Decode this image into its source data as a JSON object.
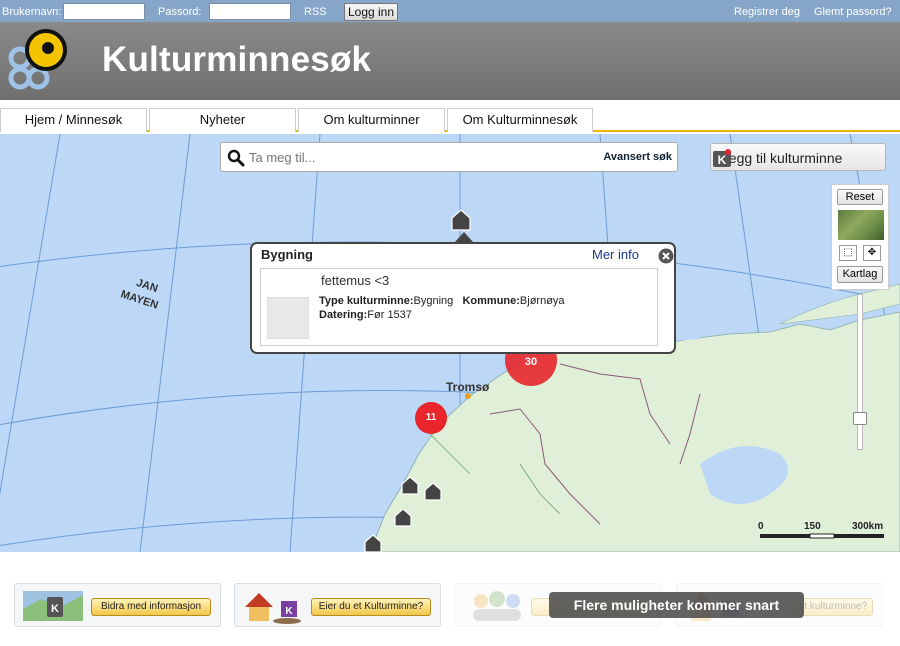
{
  "topbar": {
    "username_label": "Brukernavn:",
    "password_label": "Passord:",
    "rss": "RSS",
    "login_button": "Logg inn",
    "register": "Registrer deg",
    "forgot_password": "Glemt passord?"
  },
  "header": {
    "title": "Kulturminnesøk"
  },
  "nav": {
    "tabs": [
      {
        "label": "Hjem / Minnesøk"
      },
      {
        "label": "Nyheter"
      },
      {
        "label": "Om kulturminner"
      },
      {
        "label": "Om Kulturminnesøk"
      }
    ]
  },
  "search": {
    "placeholder": "Ta meg til...",
    "advanced": "Avansert søk"
  },
  "add_button": {
    "label": "Legg til kulturminne",
    "icon": "kulturminne-marker-icon"
  },
  "map_controls": {
    "reset": "Reset",
    "kartlag": "Kartlag",
    "zoom_level_fraction": 0.76
  },
  "popup": {
    "title": "Bygning",
    "more_info": "Mer info",
    "name": "fettemus <3",
    "type_label": "Type kulturminne:",
    "type_value": "Bygning",
    "kommune_label": "Kommune:",
    "kommune_value": "Bjørnøya",
    "datering_label": "Datering:",
    "datering_value": "Før 1537"
  },
  "map": {
    "labels": {
      "jan_mayen_1": "JAN",
      "jan_mayen_2": "MAYEN",
      "tromso": "Tromsø"
    },
    "clusters": [
      {
        "count": "30"
      },
      {
        "count": "11"
      }
    ],
    "scale": {
      "zero": "0",
      "mid": "150",
      "end": "300km"
    },
    "colors": {
      "sea": "#bcd8f6",
      "land": "#dfefd8",
      "cluster": "#e8262b"
    }
  },
  "bottom": {
    "cards": [
      {
        "button": "Bidra med informasjon"
      },
      {
        "button": "Eier du et Kulturminne?"
      },
      {
        "button": ""
      },
      {
        "button": "et kulturminne?"
      }
    ],
    "coming_soon": "Flere muligheter kommer snart"
  }
}
